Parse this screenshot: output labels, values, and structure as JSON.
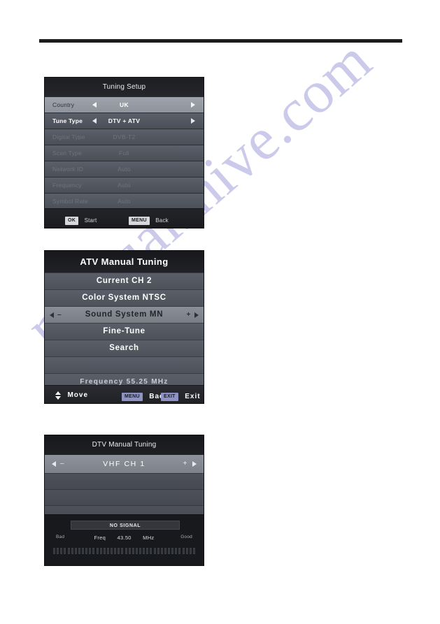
{
  "page": {
    "watermark": "manualshive.com",
    "rule": "horizontal-rule"
  },
  "tuning_setup": {
    "title": "Tuning Setup",
    "rows": [
      {
        "label": "Country",
        "value": "UK",
        "state": "selected",
        "arrows": true
      },
      {
        "label": "Tune Type",
        "value": "DTV + ATV",
        "state": "active",
        "arrows": true
      },
      {
        "label": "Digital Type",
        "value": "DVB-T2",
        "state": "disabled",
        "arrows": false
      },
      {
        "label": "Scan Type",
        "value": "Full",
        "state": "disabled",
        "arrows": false
      },
      {
        "label": "Network ID",
        "value": "Auto",
        "state": "disabled",
        "arrows": false
      },
      {
        "label": "Frequency",
        "value": "Auto",
        "state": "disabled",
        "arrows": false
      },
      {
        "label": "Symbol Rate",
        "value": "Auto",
        "state": "disabled",
        "arrows": false
      }
    ],
    "footer": {
      "ok_key": "OK",
      "ok_action": "Start",
      "menu_key": "MENU",
      "menu_action": "Back"
    }
  },
  "atv_manual_tuning": {
    "title": "ATV Manual Tuning",
    "rows": [
      {
        "label": "Current CH 2",
        "state": "normal",
        "adjust": false
      },
      {
        "label": "Color System NTSC",
        "state": "normal",
        "adjust": false
      },
      {
        "label": "Sound System MN",
        "state": "selected",
        "adjust": true
      },
      {
        "label": "Fine-Tune",
        "state": "normal",
        "adjust": false
      },
      {
        "label": "Search",
        "state": "normal",
        "adjust": false
      },
      {
        "label": "",
        "state": "blank",
        "adjust": false
      }
    ],
    "frequency_line": "Frequency  55.25 MHz",
    "footer": {
      "move_label": "Move",
      "menu_key": "MENU",
      "menu_action": "Back",
      "exit_key": "EXIT",
      "exit_action": "Exit"
    },
    "adjust_minus": "–",
    "adjust_plus": "+"
  },
  "dtv_manual_tuning": {
    "title": "DTV Manual Tuning",
    "channel_row": "VHF  CH   1",
    "adjust_minus": "–",
    "adjust_plus": "+",
    "empty_rows": 3,
    "signal": {
      "status": "NO SIGNAL",
      "bad_label": "Bad",
      "good_label": "Good",
      "freq_label": "Freq",
      "freq_value": "43.50",
      "freq_unit": "MHz",
      "segments_total": 40,
      "segments_filled": 0
    }
  },
  "colors": {
    "panel_bg": "#3f434c",
    "row_normal": "#5a5e68",
    "row_selected": "#8e939c",
    "title_bar": "#1d1e22",
    "text_primary": "#ffffff",
    "text_disabled": "#6f737c",
    "watermark": "#b9b6e4"
  }
}
